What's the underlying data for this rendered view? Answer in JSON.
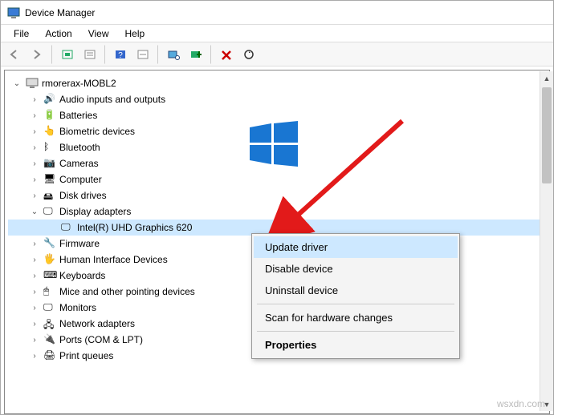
{
  "window": {
    "title": "Device Manager"
  },
  "menu": {
    "file": "File",
    "action": "Action",
    "view": "View",
    "help": "Help"
  },
  "toolbar": {
    "back": "←",
    "forward": "→",
    "up": "⬚",
    "show": "▭",
    "info": "?",
    "refresh": "🖵",
    "scan": "🖥",
    "add": "⊕",
    "remove": "✖",
    "update": "⟳"
  },
  "root": "rmorerax-MOBL2",
  "nodes": [
    {
      "label": "Audio inputs and outputs",
      "icon": "🔊"
    },
    {
      "label": "Batteries",
      "icon": "🔋"
    },
    {
      "label": "Biometric devices",
      "icon": "👆"
    },
    {
      "label": "Bluetooth",
      "icon": "ᛒ"
    },
    {
      "label": "Cameras",
      "icon": "📷"
    },
    {
      "label": "Computer",
      "icon": "🖥"
    },
    {
      "label": "Disk drives",
      "icon": "🖴"
    },
    {
      "label": "Display adapters",
      "icon": "🖵",
      "expanded": true,
      "children": [
        {
          "label": "Intel(R) UHD Graphics 620",
          "icon": "🖵",
          "selected": true
        }
      ]
    },
    {
      "label": "Firmware",
      "icon": "🔧"
    },
    {
      "label": "Human Interface Devices",
      "icon": "🖐"
    },
    {
      "label": "Keyboards",
      "icon": "⌨"
    },
    {
      "label": "Mice and other pointing devices",
      "icon": "🖱"
    },
    {
      "label": "Monitors",
      "icon": "🖵"
    },
    {
      "label": "Network adapters",
      "icon": "🖧"
    },
    {
      "label": "Ports (COM & LPT)",
      "icon": "🔌"
    },
    {
      "label": "Print queues",
      "icon": "🖨"
    }
  ],
  "context_menu": {
    "update": "Update driver",
    "disable": "Disable device",
    "uninstall": "Uninstall device",
    "scan": "Scan for hardware changes",
    "properties": "Properties"
  },
  "watermark": "wsxdn.com",
  "colors": {
    "highlight": "#cde8ff",
    "arrow": "#e21a1a",
    "logo": "#1976d2"
  }
}
